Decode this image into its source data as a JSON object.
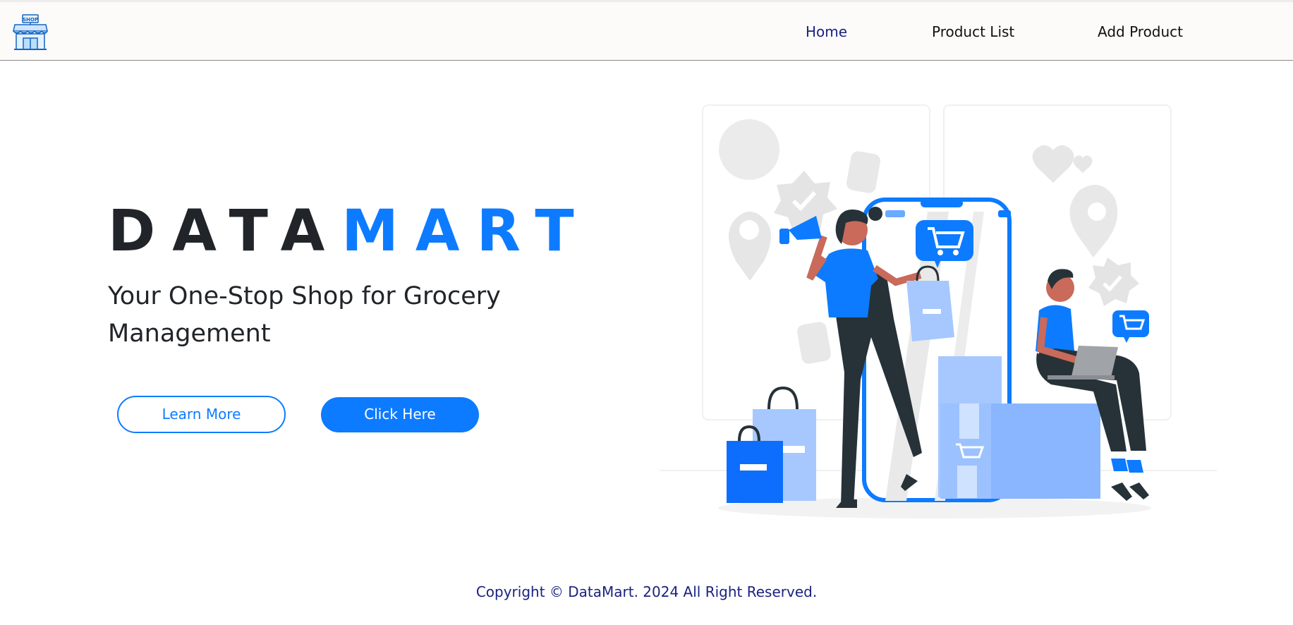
{
  "nav": {
    "logo_text": "SHOP",
    "links": [
      {
        "label": "Home",
        "active": true
      },
      {
        "label": "Product List",
        "active": false
      },
      {
        "label": "Add Product",
        "active": false
      }
    ]
  },
  "hero": {
    "brand_dark": "DATA",
    "brand_accent": "MART",
    "tagline": "Your One-Stop Shop for Grocery Management",
    "learn_more_label": "Learn More",
    "click_here_label": "Click Here"
  },
  "footer": {
    "copyright": "Copyright © DataMart. 2024 All Right Reserved."
  },
  "icons": {
    "logo": "shop-storefront-icon",
    "illustration": "shopping-people-illustration"
  },
  "colors": {
    "accent": "#0d7bff",
    "text_dark": "#212529",
    "nav_active": "#1a237e",
    "footer_text": "#1a237e"
  }
}
